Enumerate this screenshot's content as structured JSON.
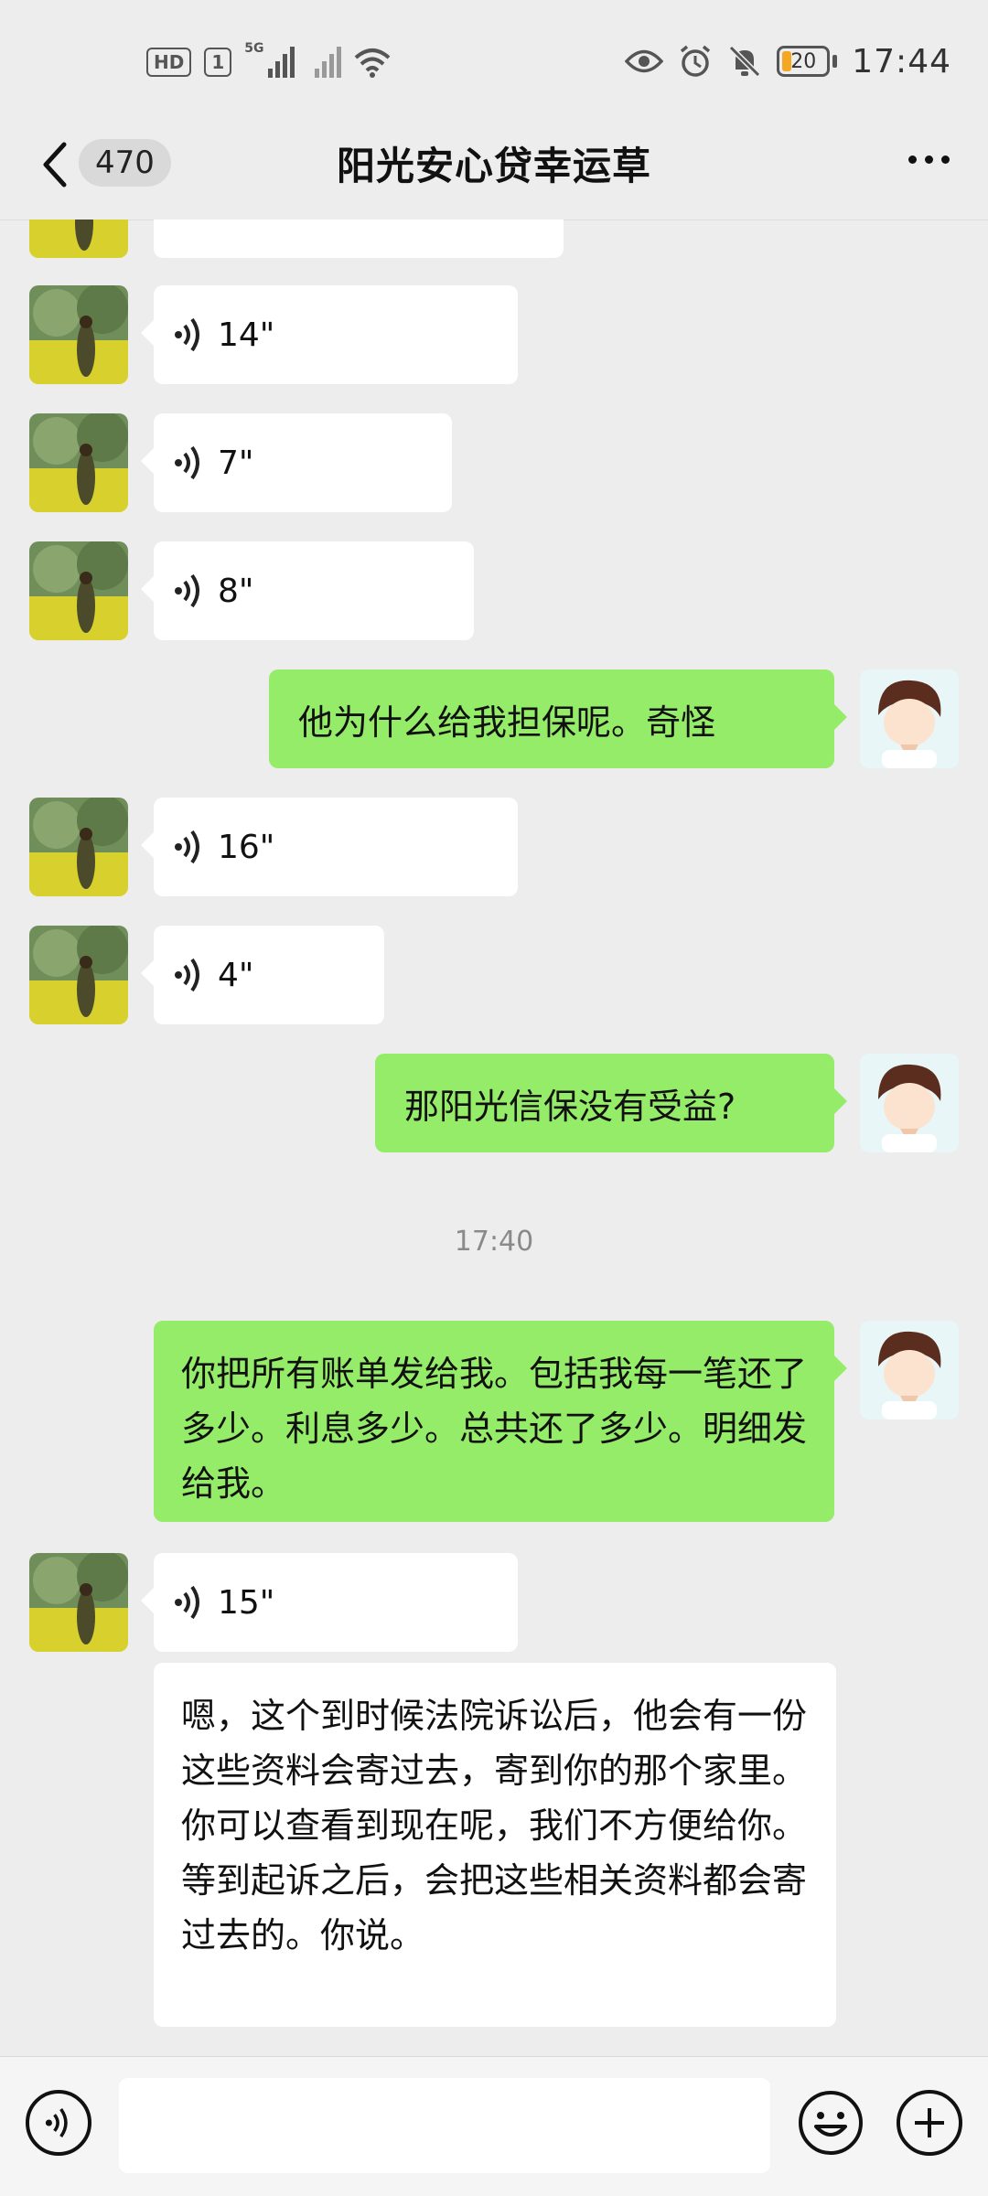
{
  "status_bar": {
    "hd_label": "HD",
    "sim_number": "1",
    "network": "5G",
    "time": "17:44",
    "battery_level": "20",
    "battery_color": "#f5a623"
  },
  "header": {
    "unread_count": "470",
    "title": "阳光安心贷幸运草"
  },
  "messages": {
    "m1_duration": "14\"",
    "m2_duration": "7\"",
    "m3_duration": "8\"",
    "m4_text": "他为什么给我担保呢。奇怪",
    "m5_duration": "16\"",
    "m6_duration": "4\"",
    "m7_text": "那阳光信保没有受益?",
    "timestamp_1740": "17:40",
    "m8_text": "你把所有账单发给我。包括我每一笔还了多少。利息多少。总共还了多少。明细发给我。",
    "m9_duration": "15\"",
    "m10_text": "嗯，这个到时候法院诉讼后，他会有一份这些资料会寄过去，寄到你的那个家里。你可以查看到现在呢，我们不方便给你。等到起诉之后，会把这些相关资料都会寄过去的。你说。"
  },
  "colors": {
    "my_bubble": "#95ec69",
    "their_bubble": "#ffffff",
    "background": "#ededed"
  }
}
